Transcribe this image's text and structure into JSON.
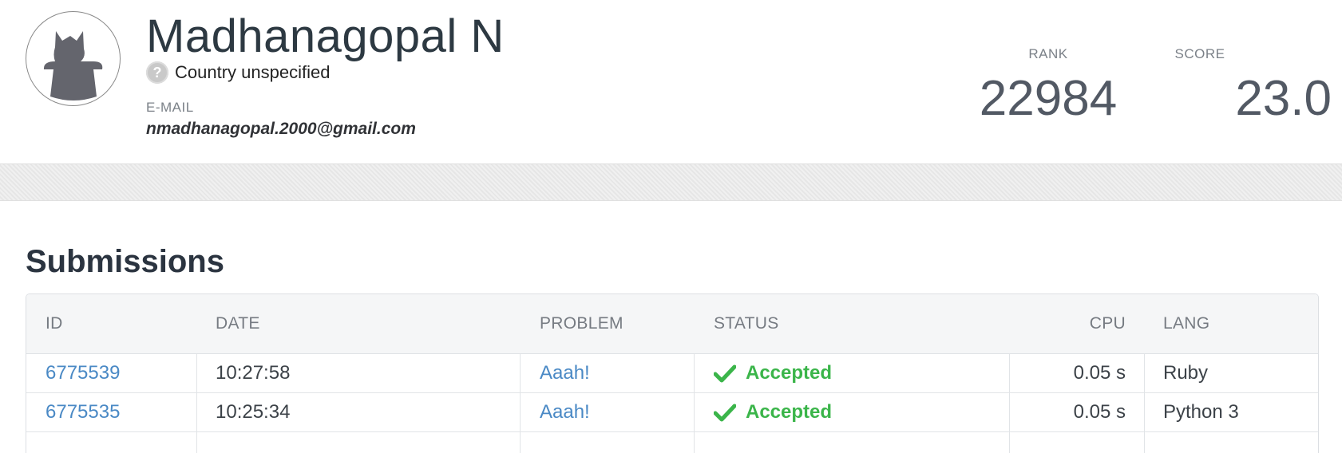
{
  "profile": {
    "name": "Madhanagopal N",
    "country_icon_symbol": "?",
    "country": "Country unspecified",
    "email_label": "E-MAIL",
    "email": "nmadhanagopal.2000@gmail.com",
    "rank_label": "RANK",
    "rank": "22984",
    "score_label": "SCORE",
    "score": "23.0"
  },
  "submissions": {
    "title": "Submissions",
    "columns": {
      "id": "ID",
      "date": "DATE",
      "problem": "PROBLEM",
      "status": "STATUS",
      "cpu": "CPU",
      "lang": "LANG"
    },
    "rows": [
      {
        "id": "6775539",
        "date": "10:27:58",
        "problem": "Aaah!",
        "status": "Accepted",
        "cpu": "0.05 s",
        "lang": "Ruby"
      },
      {
        "id": "6775535",
        "date": "10:25:34",
        "problem": "Aaah!",
        "status": "Accepted",
        "cpu": "0.05 s",
        "lang": "Python 3"
      }
    ]
  },
  "colors": {
    "link": "#4a89c5",
    "accepted": "#3bb54a",
    "heading": "#2b3440"
  },
  "icons": {
    "avatar": "cat-silhouette-avatar-icon",
    "country": "question-mark-icon",
    "status": "checkmark-icon"
  }
}
